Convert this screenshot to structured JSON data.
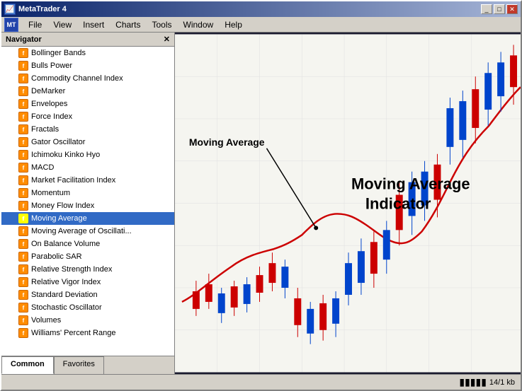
{
  "window": {
    "title": "MetaTrader 4",
    "buttons": {
      "minimize": "_",
      "maximize": "□",
      "close": "✕"
    }
  },
  "menu": {
    "app_icon": "MT",
    "items": [
      "File",
      "View",
      "Insert",
      "Charts",
      "Tools",
      "Window",
      "Help"
    ]
  },
  "navigator": {
    "title": "Navigator",
    "close_btn": "✕",
    "indicators": [
      "Bollinger Bands",
      "Bulls Power",
      "Commodity Channel Index",
      "DeMarker",
      "Envelopes",
      "Force Index",
      "Fractals",
      "Gator Oscillator",
      "Ichimoku Kinko Hyo",
      "MACD",
      "Market Facilitation Index",
      "Momentum",
      "Money Flow Index",
      "Moving Average",
      "Moving Average of Oscillati...",
      "On Balance Volume",
      "Parabolic SAR",
      "Relative Strength Index",
      "Relative Vigor Index",
      "Standard Deviation",
      "Stochastic Oscillator",
      "Volumes",
      "Williams' Percent Range"
    ],
    "selected_index": 13,
    "tabs": [
      "Common",
      "Favorites"
    ]
  },
  "chart": {
    "label_ma": "Moving Average",
    "label_mai_line1": "Moving Average",
    "label_mai_line2": "Indicator"
  },
  "status_bar": {
    "icon": "▮▮▮▮▮",
    "size": "14/1 kb"
  }
}
